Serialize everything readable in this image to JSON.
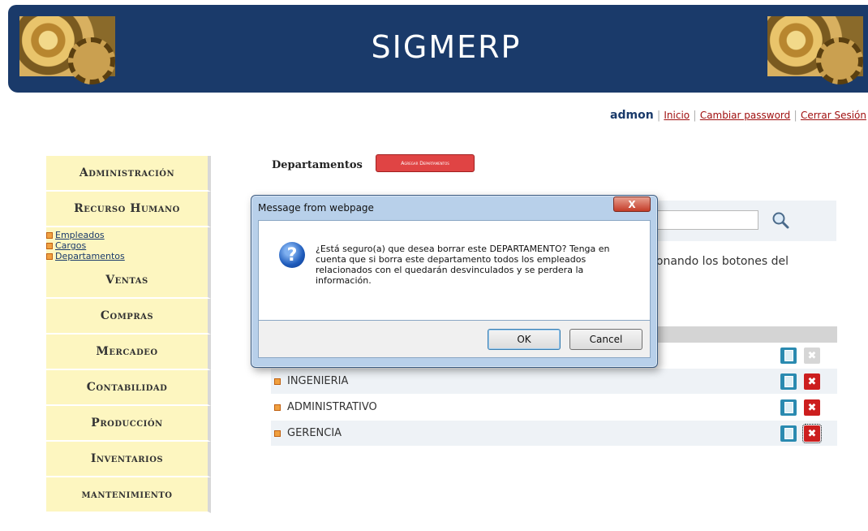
{
  "header": {
    "title": "SIGMERP"
  },
  "userbar": {
    "username": "admon",
    "sep": "|",
    "links": [
      "Inicio",
      "Cambiar password",
      "Cerrar Sesión"
    ]
  },
  "sidebar": {
    "items": [
      {
        "label": "Administración"
      },
      {
        "label": "Recurso Humano"
      },
      {
        "label": "Ventas"
      },
      {
        "label": "Compras"
      },
      {
        "label": "Mercadeo"
      },
      {
        "label": "Contabilidad"
      },
      {
        "label": "Producción"
      },
      {
        "label": "Inventarios"
      },
      {
        "label": "mantenimiento"
      }
    ],
    "submenu": [
      "Empleados",
      "Cargos",
      "Departamentos"
    ]
  },
  "content": {
    "title": "Departamentos",
    "add_button": "Agregar Departamentos",
    "help_text": "ionando los botones del"
  },
  "departments": [
    "INGENIERIA",
    "ADMINISTRATIVO",
    "GERENCIA"
  ],
  "dialog": {
    "title": "Message from webpage",
    "close_glyph": "X",
    "icon_glyph": "?",
    "message": "¿Está seguro(a) que desea borrar este DEPARTAMENTO? Tenga en cuenta que si borra este departamento todos los empleados relacionados con el quedarán desvinculados y se perdera la información.",
    "ok_label": "OK",
    "cancel_label": "Cancel"
  },
  "actions": {
    "delete_glyph": "✖"
  },
  "colors": {
    "header_bg": "#1a3a6a",
    "menu_bg": "#fdf6c0",
    "add_button_bg": "#e04444",
    "delete_bg": "#cc1e1e",
    "edit_bg": "#2a8ab0"
  }
}
